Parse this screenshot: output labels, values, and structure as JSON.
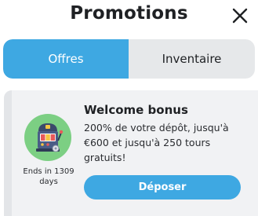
{
  "header": {
    "title": "Promotions",
    "close_icon": "close-icon"
  },
  "tabs": [
    {
      "label": "Offres",
      "active": true
    },
    {
      "label": "Inventaire",
      "active": false
    }
  ],
  "promotion": {
    "icon": "slot-machine-icon",
    "expiry": "Ends in 1309 days",
    "title": "Welcome bonus",
    "description": "200% de votre dépôt, jusqu'à €600 et jusqu'à 250 tours gratuits!",
    "button_label": "Déposer"
  },
  "colors": {
    "accent": "#3ea8e2",
    "icon_background": "#7ccf83",
    "card_background": "#f1f2f4"
  }
}
